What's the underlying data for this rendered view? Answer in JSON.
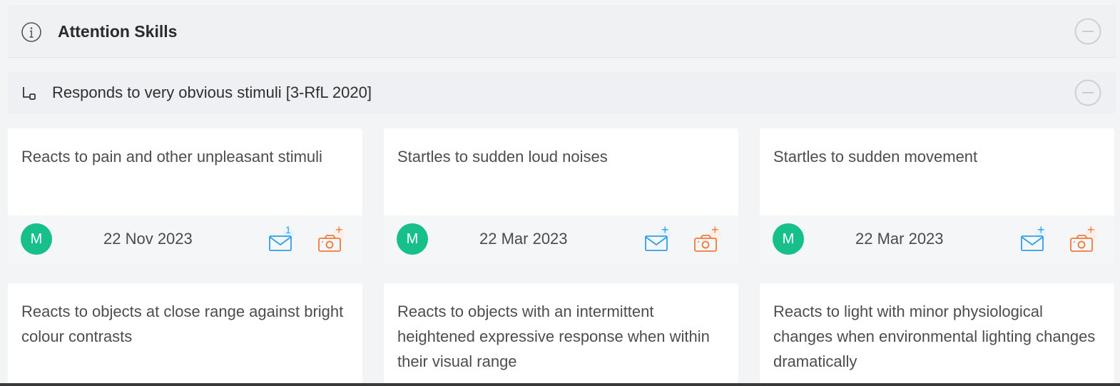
{
  "section": {
    "title": "Attention Skills"
  },
  "sub_section": {
    "title": "Responds to very obvious stimuli [3-RfL 2020]"
  },
  "cards": [
    {
      "text": "Reacts to pain and other unpleasant stimuli",
      "avatar": "M",
      "date": "22 Nov 2023",
      "mail_badge": "1"
    },
    {
      "text": "Startles to sudden loud noises",
      "avatar": "M",
      "date": "22 Mar 2023",
      "mail_badge": "+"
    },
    {
      "text": "Startles to sudden movement",
      "avatar": "M",
      "date": "22 Mar 2023",
      "mail_badge": "+"
    },
    {
      "text": "Reacts to objects at close range against bright colour contrasts"
    },
    {
      "text": "Reacts to objects with an intermittent heightened expressive response when within their visual range"
    },
    {
      "text": "Reacts to light with minor physiological changes when environmental lighting changes dramatically"
    }
  ],
  "icons": {
    "info": "info-circle-icon",
    "subitem": "subitem-arrow-icon",
    "collapse": "minus-circle-icon",
    "mail": "mail-plus-icon",
    "camera": "camera-plus-icon"
  },
  "colors": {
    "avatar": "#17c08b",
    "mail": "#2f9fe6",
    "camera": "#f07a3a"
  }
}
